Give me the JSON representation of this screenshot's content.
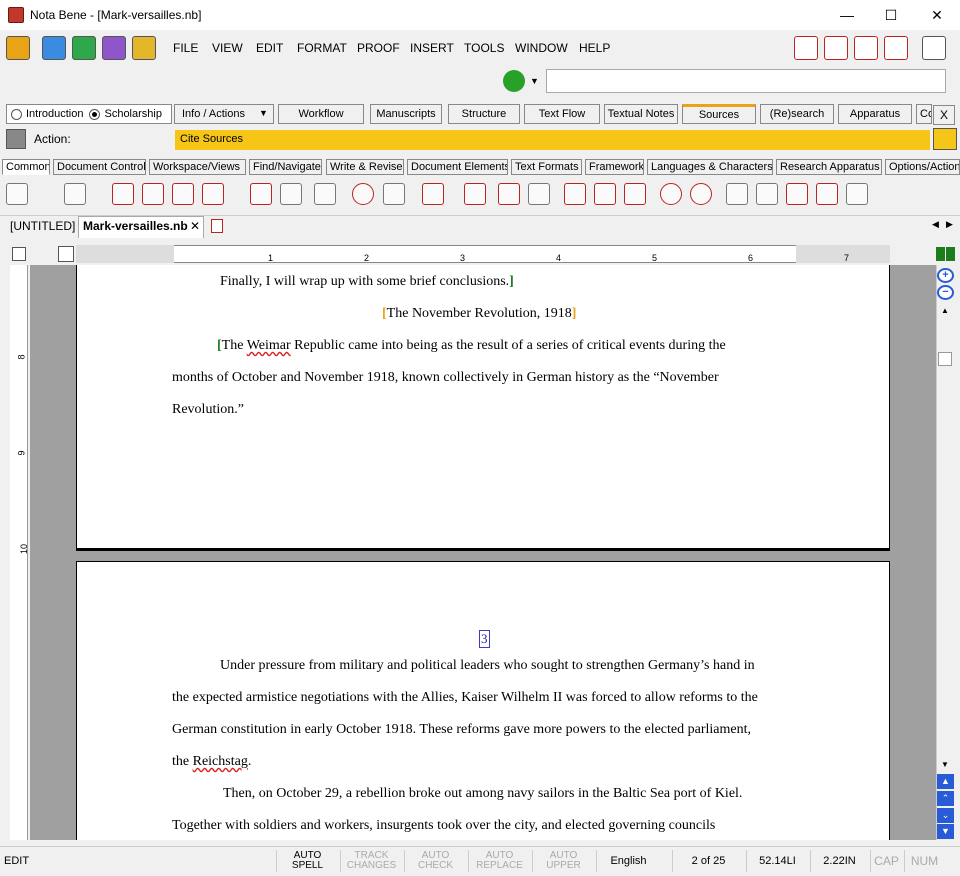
{
  "window": {
    "title": "Nota Bene - [Mark-versailles.nb]",
    "minimize": "—",
    "maximize": "☐",
    "close": "✕"
  },
  "menu": [
    "FILE",
    "VIEW",
    "EDIT",
    "FORMAT",
    "PROOF",
    "INSERT",
    "TOOLS",
    "WINDOW",
    "HELP"
  ],
  "command": {
    "input_value": ""
  },
  "mode": {
    "introduction": "Introduction",
    "scholarship": "Scholarship",
    "selected": "Scholarship"
  },
  "ribbon_tabs": [
    "Info / Actions",
    "Workflow",
    "Manuscripts",
    "Structure",
    "Text Flow",
    "Textual Notes",
    "Sources",
    "(Re)search",
    "Apparatus",
    "Co"
  ],
  "active_ribbon_tab": "Sources",
  "ribbon_close": "X",
  "action": {
    "label": "Action:",
    "value": "Cite Sources"
  },
  "categories": [
    "Common",
    "Document Control",
    "Workspace/Views",
    "Find/Navigate",
    "Write & Revise",
    "Document Elements",
    "Text Formats",
    "Framework",
    "Languages & Characters",
    "Research Apparatus",
    "Options/Actions"
  ],
  "active_category": "Common",
  "doc_tabs": {
    "untitled": "[UNTITLED]",
    "active": "Mark-versailles.nb",
    "close": "✕"
  },
  "ruler": {
    "numbers": [
      "1",
      "2",
      "3",
      "4",
      "5",
      "6",
      "7"
    ]
  },
  "vruler": {
    "numbers": [
      "8",
      "9",
      "10"
    ]
  },
  "document": {
    "page1": {
      "line1": "Finally, I will wrap up with some brief conclusions.",
      "heading": "The November Revolution, 1918",
      "p1_l1_pre": "The ",
      "p1_l1_squiggle": "Weimar",
      "p1_l1_post": " Republic came into being as the result of a series of critical events during the",
      "p1_l2": "months of October and November 1918, known collectively in German history as the “November",
      "p1_l3": "Revolution.”"
    },
    "page2": {
      "page_number": "3",
      "p1_l1": "Under pressure from military and political leaders who sought to strengthen Germany’s hand in",
      "p1_l2": "the expected armistice negotiations with the Allies, Kaiser Wilhelm II was forced to allow reforms to the",
      "p1_l3": "German constitution in early October 1918. These reforms gave more powers to the elected parliament,",
      "p1_l4_pre": "the ",
      "p1_l4_squiggle": "Reichstag",
      "p1_l4_post": ".",
      "p2_l1": "Then, on October 29, a rebellion broke out among navy sailors in the Baltic Sea port of Kiel.",
      "p2_l2": "Together with soldiers and workers, insurgents took over the city, and elected governing councils"
    }
  },
  "status": {
    "mode": "EDIT",
    "auto_spell": "AUTO SPELL",
    "track_changes": "TRACK CHANGES",
    "auto_check": "AUTO CHECK",
    "auto_replace": "AUTO REPLACE",
    "auto_upper": "AUTO UPPER",
    "language": "English",
    "page": "2 of 25",
    "line": "52.14LI",
    "inch": "2.22IN",
    "cap": "CAP",
    "num": "NUM"
  },
  "colors": {
    "accent_yellow": "#f5c518",
    "bracket_green": "#1b7d1b",
    "bracket_orange": "#e8a317",
    "scroll_blue": "#2a5bd7"
  }
}
